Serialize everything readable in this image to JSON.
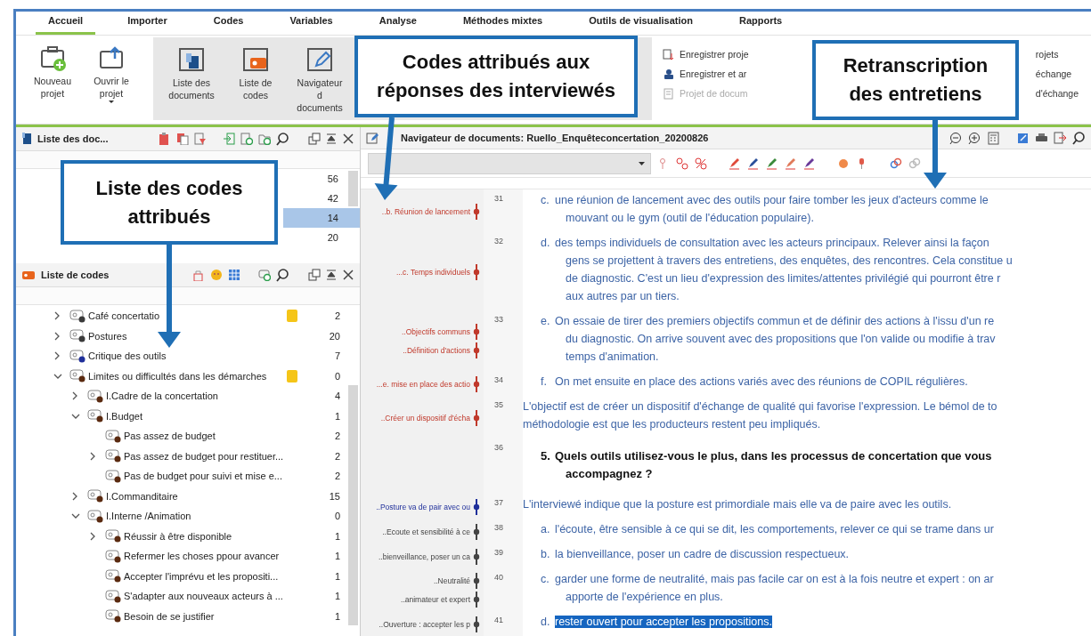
{
  "tabs": [
    {
      "label": "Accueil",
      "selected": true
    },
    {
      "label": "Importer",
      "selected": false
    },
    {
      "label": "Codes",
      "selected": false
    },
    {
      "label": "Variables",
      "selected": false
    },
    {
      "label": "Analyse",
      "selected": false
    },
    {
      "label": "Méthodes mixtes",
      "selected": false
    },
    {
      "label": "Outils de visualisation",
      "selected": false
    },
    {
      "label": "Rapports",
      "selected": false
    }
  ],
  "ribbon": {
    "large_buttons": [
      {
        "label": "Nouveau\nprojet",
        "kind": "plain",
        "dropdown": false
      },
      {
        "label": "Ouvrir le\nprojet",
        "kind": "plain",
        "dropdown": true
      },
      {
        "label": "Liste des\ndocuments",
        "kind": "shaded",
        "dropdown": false
      },
      {
        "label": "Liste de\ncodes",
        "kind": "shaded",
        "dropdown": false
      },
      {
        "label": "Navigateur d\ndocuments",
        "kind": "shaded",
        "dropdown": false
      }
    ],
    "small_buttons_left": [
      {
        "label": "Enregistrer proje",
        "disabled": false
      },
      {
        "label": "Enregistrer et ar",
        "disabled": false
      },
      {
        "label": "Projet de docum",
        "disabled": true
      }
    ],
    "small_buttons_right": [
      {
        "label": "rojets"
      },
      {
        "label": "échange"
      },
      {
        "label": "d'échange"
      }
    ]
  },
  "document_list": {
    "title": "Liste des doc...",
    "rows": [
      {
        "count": "56",
        "selected": false
      },
      {
        "count": "42",
        "selected": false
      },
      {
        "count": "14",
        "selected": true
      },
      {
        "count": "20",
        "selected": false
      }
    ]
  },
  "code_list": {
    "title": "Liste de codes",
    "codes": [
      {
        "label": "Café concertatio",
        "count": "2",
        "memo": true,
        "color": "#3a3a3a",
        "expanded": false
      },
      {
        "label": "Postures",
        "count": "20",
        "memo": false,
        "color": "#3a3a3a",
        "expanded": false
      },
      {
        "label": "Critique des outils",
        "count": "7",
        "memo": false,
        "color": "#1f2f9a",
        "expanded": false
      },
      {
        "label": "Limites ou difficultés dans les démarches",
        "count": "0",
        "memo": true,
        "color": "#5a2a10",
        "expanded": true,
        "children": [
          {
            "label": "I.Cadre de la concertation",
            "count": "4",
            "memo": false,
            "color": "#5a2a10",
            "expanded": false
          },
          {
            "label": "I.Budget",
            "count": "1",
            "memo": false,
            "color": "#5a2a10",
            "expanded": true,
            "children": [
              {
                "label": "Pas assez de budget",
                "count": "2",
                "memo": false,
                "color": "#5a2a10"
              },
              {
                "label": "Pas assez de budget pour restituer...",
                "count": "2",
                "memo": false,
                "color": "#5a2a10",
                "expanded": false
              },
              {
                "label": "Pas de budget pour suivi et mise e...",
                "count": "2",
                "memo": false,
                "color": "#5a2a10"
              }
            ]
          },
          {
            "label": "I.Commanditaire",
            "count": "15",
            "memo": false,
            "color": "#5a2a10",
            "expanded": false
          },
          {
            "label": "I.Interne /Animation",
            "count": "0",
            "memo": false,
            "color": "#5a2a10",
            "expanded": true,
            "children": [
              {
                "label": "Réussir à être disponible",
                "count": "1",
                "memo": false,
                "color": "#5a2a10",
                "expanded": false
              },
              {
                "label": "Refermer les choses ppour avancer",
                "count": "1",
                "memo": false,
                "color": "#5a2a10"
              },
              {
                "label": "Accepter l'imprévu et les propositi...",
                "count": "1",
                "memo": false,
                "color": "#5a2a10"
              },
              {
                "label": "S'adapter aux nouveaux acteurs à ...",
                "count": "1",
                "memo": false,
                "color": "#5a2a10"
              },
              {
                "label": "Besoin de se justifier",
                "count": "1",
                "memo": false,
                "color": "#5a2a10"
              }
            ]
          }
        ]
      }
    ]
  },
  "navigator": {
    "title": "Navigateur de documents: Ruello_Enquêteconcertation_20200826",
    "paragraphs": [
      {
        "number": "31",
        "kind": "item",
        "marker": "c.",
        "selected": false,
        "codes": [
          {
            "label": "..b. Réunion de lancement",
            "color": "#c0392b"
          }
        ],
        "lines": [
          "une réunion de lancement avec des outils pour faire tomber les jeux d'acteurs comme le",
          "mouvant ou le gym (outil de l'éducation populaire)."
        ]
      },
      {
        "number": "32",
        "kind": "item",
        "marker": "d.",
        "selected": false,
        "codes": [
          {
            "label": "...c. Temps individuels",
            "color": "#c0392b"
          }
        ],
        "lines": [
          "des temps individuels de consultation avec les acteurs principaux. Relever ainsi la façon",
          "gens se projettent à travers des entretiens, des enquêtes, des rencontres. Cela constitue u",
          "de diagnostic. C'est un lieu d'expression des limites/attentes privilégié qui pourront être r",
          "aux autres par un tiers."
        ]
      },
      {
        "number": "33",
        "kind": "item",
        "marker": "e.",
        "selected": false,
        "codes": [
          {
            "label": "..Objectifs communs",
            "color": "#c0392b"
          },
          {
            "label": "..Définition d'actions",
            "color": "#c0392b"
          }
        ],
        "lines": [
          "On essaie de tirer des premiers objectifs commun et de définir des actions à l'issu d'un re",
          "du diagnostic. On arrive souvent avec des propositions que l'on valide ou modifie à trav",
          "temps d'animation."
        ]
      },
      {
        "number": "34",
        "kind": "item",
        "marker": "f.",
        "selected": false,
        "codes": [
          {
            "label": "...e. mise en place des actio",
            "color": "#c0392b"
          }
        ],
        "lines": [
          "On met ensuite en place des actions variés avec des réunions de COPIL régulières."
        ]
      },
      {
        "number": "35",
        "kind": "plain",
        "selected": false,
        "codes": [
          {
            "label": "..Créer un dispositif d'écha",
            "color": "#c0392b"
          }
        ],
        "lines": [
          "L'objectif est de créer un dispositif d'échange de qualité qui favorise l'expression. Le bémol de to",
          "méthodologie est que les producteurs restent peu impliqués."
        ]
      },
      {
        "number": "36",
        "kind": "heading",
        "marker": "5.",
        "selected": false,
        "lines": [
          "Quels outils utilisez-vous le plus, dans les processus de concertation que vous",
          "accompagnez ?"
        ]
      },
      {
        "number": "37",
        "kind": "plain",
        "selected": false,
        "codes": [
          {
            "label": "..Posture va de pair avec ou",
            "color": "#1f2f9a"
          }
        ],
        "lines": [
          "L'interviewé indique que la posture est primordiale mais elle va de paire avec les outils."
        ]
      },
      {
        "number": "38",
        "kind": "item",
        "marker": "a.",
        "selected": false,
        "codes": [
          {
            "label": "..Ecoute et sensibilité à ce",
            "color": "#444444"
          }
        ],
        "lines": [
          "l'écoute, être sensible à ce qui se dit, les comportements, relever ce qui se trame dans ur"
        ]
      },
      {
        "number": "39",
        "kind": "item",
        "marker": "b.",
        "selected": false,
        "codes": [
          {
            "label": "..bienveillance, poser un ca",
            "color": "#444444"
          }
        ],
        "lines": [
          "la bienveillance, poser un cadre de discussion respectueux."
        ]
      },
      {
        "number": "40",
        "kind": "item",
        "marker": "c.",
        "selected": false,
        "codes": [
          {
            "label": "..Neutralité",
            "color": "#444444"
          },
          {
            "label": "..animateur et expert",
            "color": "#444444"
          }
        ],
        "lines": [
          "garder une forme de neutralité, mais pas facile car on est à la fois neutre et expert : on ar",
          "apporte de l'expérience en plus."
        ]
      },
      {
        "number": "41",
        "kind": "item",
        "marker": "d.",
        "selected": true,
        "codes": [
          {
            "label": "..Ouverture : accepter les p",
            "color": "#444444"
          }
        ],
        "lines": [
          "rester ouvert pour accepter les propositions."
        ]
      }
    ]
  },
  "callouts": [
    {
      "text": "Codes attribués aux\nréponses des interviewés"
    },
    {
      "text": "Retranscription\ndes entretiens"
    },
    {
      "text": "Liste des codes\nattribués"
    }
  ]
}
